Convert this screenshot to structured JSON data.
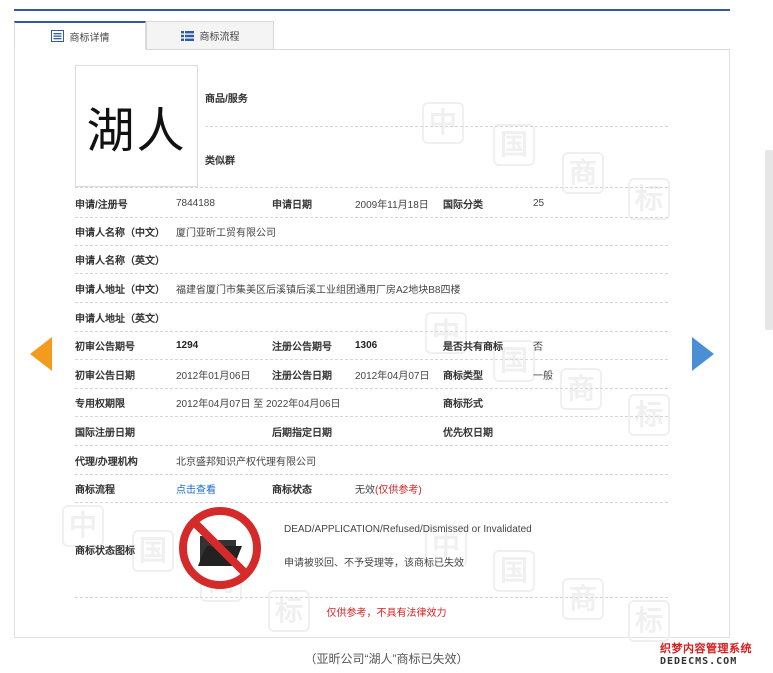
{
  "tabs": [
    {
      "label": "商标详情",
      "active": true,
      "icon": "list-icon"
    },
    {
      "label": "商标流程",
      "active": false,
      "icon": "flow-list-icon"
    }
  ],
  "logo": {
    "text": "湖人"
  },
  "header": {
    "goods_label": "商品/服务",
    "similar_label": "类似群"
  },
  "rows": {
    "r1": {
      "l1": "申请/注册号",
      "v1": "7844188",
      "l2": "申请日期",
      "v2": "2009年11月18日",
      "l3": "国际分类",
      "v3": "25"
    },
    "r2": {
      "l1": "申请人名称（中文）",
      "v1": "厦门亚昕工贸有限公司"
    },
    "r3": {
      "l1": "申请人名称（英文）",
      "v1": ""
    },
    "r4": {
      "l1": "申请人地址（中文）",
      "v1": "福建省厦门市集美区后溪镇后溪工业组团通用厂房A2地块B8四楼"
    },
    "r5": {
      "l1": "申请人地址（英文）",
      "v1": ""
    },
    "r6": {
      "l1": "初审公告期号",
      "v1": "1294",
      "l2": "注册公告期号",
      "v2": "1306",
      "l3": "是否共有商标",
      "v3": "否"
    },
    "r7": {
      "l1": "初审公告日期",
      "v1": "2012年01月06日",
      "l2": "注册公告日期",
      "v2": "2012年04月07日",
      "l3": "商标类型",
      "v3": "一般"
    },
    "r8": {
      "l1": "专用权期限",
      "v1": "2012年04月07日 至 2022年04月06日",
      "l3": "商标形式",
      "v3": ""
    },
    "r9": {
      "l1": "国际注册日期",
      "v1": "",
      "l2": "后期指定日期",
      "v2": "",
      "l3": "优先权日期",
      "v3": ""
    },
    "r10": {
      "l1": "代理/办理机构",
      "v1": "北京盛邦知识产权代理有限公司"
    },
    "r11": {
      "l1": "商标流程",
      "v1": "点击查看",
      "l2": "商标状态",
      "v2": "无效",
      "v2_note": "(仅供参考)"
    }
  },
  "status": {
    "label": "商标状态图标",
    "icon": "invalid-folder-icon",
    "en": "DEAD/APPLICATION/Refused/Dismissed or Invalidated",
    "cn": "申请被驳回、不予受理等，该商标已失效"
  },
  "disclaimer": "仅供参考，不具有法律效力",
  "caption": "（亚昕公司“湖人”商标已失效）",
  "watermark": {
    "chars": [
      "中",
      "国",
      "商",
      "标"
    ]
  },
  "site_mark": {
    "top": "织梦内容管理系统",
    "bottom": "DEDECMS.COM"
  },
  "colors": {
    "accent": "#2f5aa8",
    "left_arrow": "#f39b1c",
    "right_arrow": "#4a8fd6",
    "warning": "#d82020",
    "link": "#1a6cc0"
  }
}
